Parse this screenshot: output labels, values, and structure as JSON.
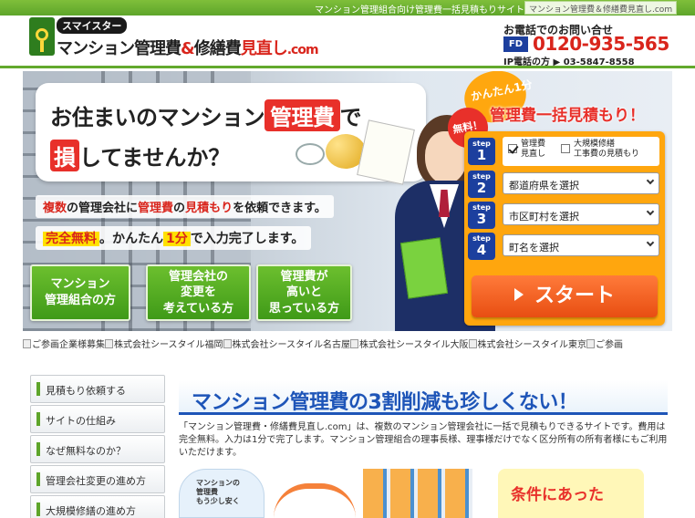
{
  "topbar": {
    "tagline": "マンション管理組合向け管理費一括見積もりサイト！",
    "site_name": "マンション管理費＆修繕費見直し.com"
  },
  "header": {
    "logo_badge": "スマイスター",
    "logo_main": "マンション管理費",
    "logo_amp": "&",
    "logo_mid": "修繕費",
    "logo_red": "見直し",
    "logo_dot": ".com",
    "contact_title": "お電話でのお問い合せ",
    "freedial_icon": "FD",
    "freedial_number": "0120-935-565",
    "ip_phone": "IP電話の方 ▶ 03-5847-8558"
  },
  "hero": {
    "line1_pre": "お住まいのマンション",
    "line1_hl": "管理費",
    "line1_post": "で",
    "line2_hl": "損",
    "line2_post": "してませんか？",
    "info1_a": "複数",
    "info1_b": "の管理会社に",
    "info1_c": "管理費",
    "info1_d": "の",
    "info1_e": "見積もり",
    "info1_f": "を依頼できます。",
    "info2_a": "完全無料",
    "info2_b": "。かんたん",
    "info2_c": "1分",
    "info2_d": "で入力完了します。",
    "buttons": [
      {
        "label": "マンション\n管理組合の方"
      },
      {
        "label": "管理会社の\n変更を\n考えている方"
      },
      {
        "label": "管理費が\n高いと\n思っている方"
      }
    ]
  },
  "form": {
    "badge": "かんたん1分",
    "free_badge": "無料！",
    "title": "管理費一括見積もり！",
    "step_word": "step",
    "steps": [
      "1",
      "2",
      "3",
      "4"
    ],
    "check1_label": "管理費\n見直し",
    "check2_label": "大規模修繕\n工事費の見積もり",
    "select_prefecture": "都道府県を選択",
    "select_city": "市区町村を選択",
    "select_town": "町名を選択",
    "start_label": "スタート"
  },
  "linkrow": {
    "items": [
      "ご参画企業様募集",
      "株式会社シースタイル福岡",
      "株式会社シースタイル名古屋",
      "株式会社シースタイル大阪",
      "株式会社シースタイル東京",
      "ご参画"
    ]
  },
  "sidebar": {
    "items": [
      {
        "label": "見積もり依頼する"
      },
      {
        "label": "サイトの仕組み"
      },
      {
        "label": "なぜ無料なのか？"
      },
      {
        "label": "管理会社変更の進め方"
      },
      {
        "label": "大規模修繕の進め方"
      }
    ]
  },
  "main": {
    "heading": "マンション管理費の3割削減も珍しくない！",
    "body": "「マンション管理費・修繕費見直し.com」は、複数のマンション管理会社に一括で見積もりできるサイトです。費用は完全無料。入力は1分で完了します。マンション管理組合の理事長様、理事様だけでなく区分所有の所有者様にもご利用いただけます。",
    "thumb_cloud": "マンションの\n管理費\nもう少し安く",
    "thumb_yellow": "条件にあった"
  }
}
